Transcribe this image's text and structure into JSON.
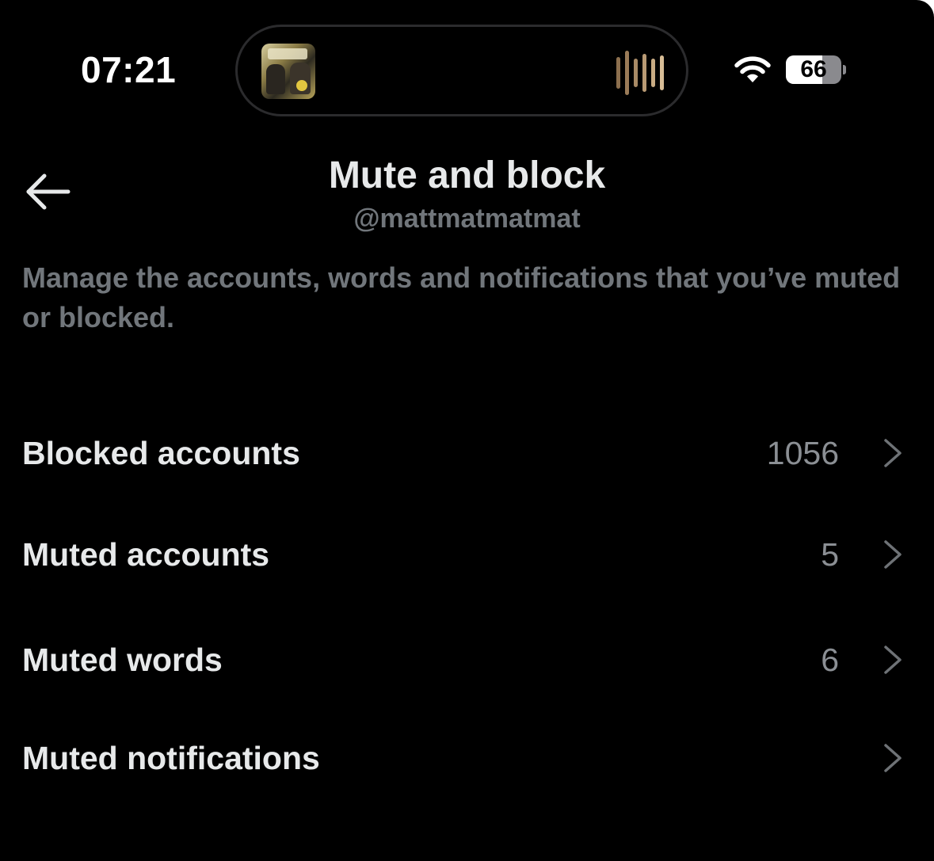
{
  "status_bar": {
    "time": "07:21",
    "battery_percent": "66",
    "battery_level": 0.66,
    "wifi_icon": "wifi-icon",
    "now_playing_icon": "waveform-icon",
    "album_art": "album-art-thumbnail"
  },
  "header": {
    "back_icon": "arrow-left-icon",
    "title": "Mute and block",
    "handle": "@mattmatmatmat"
  },
  "description": "Manage the accounts, words and notifications that you’ve muted or blocked.",
  "items": [
    {
      "label": "Blocked accounts",
      "count": "1056",
      "icon": "chevron-right-icon"
    },
    {
      "label": "Muted accounts",
      "count": "5",
      "icon": "chevron-right-icon"
    },
    {
      "label": "Muted words",
      "count": "6",
      "icon": "chevron-right-icon"
    },
    {
      "label": "Muted notifications",
      "count": "",
      "icon": "chevron-right-icon"
    }
  ],
  "colors": {
    "background": "#000000",
    "primary_text": "#e7e9ea",
    "secondary_text": "#71767b",
    "chevron": "#6e7276"
  }
}
